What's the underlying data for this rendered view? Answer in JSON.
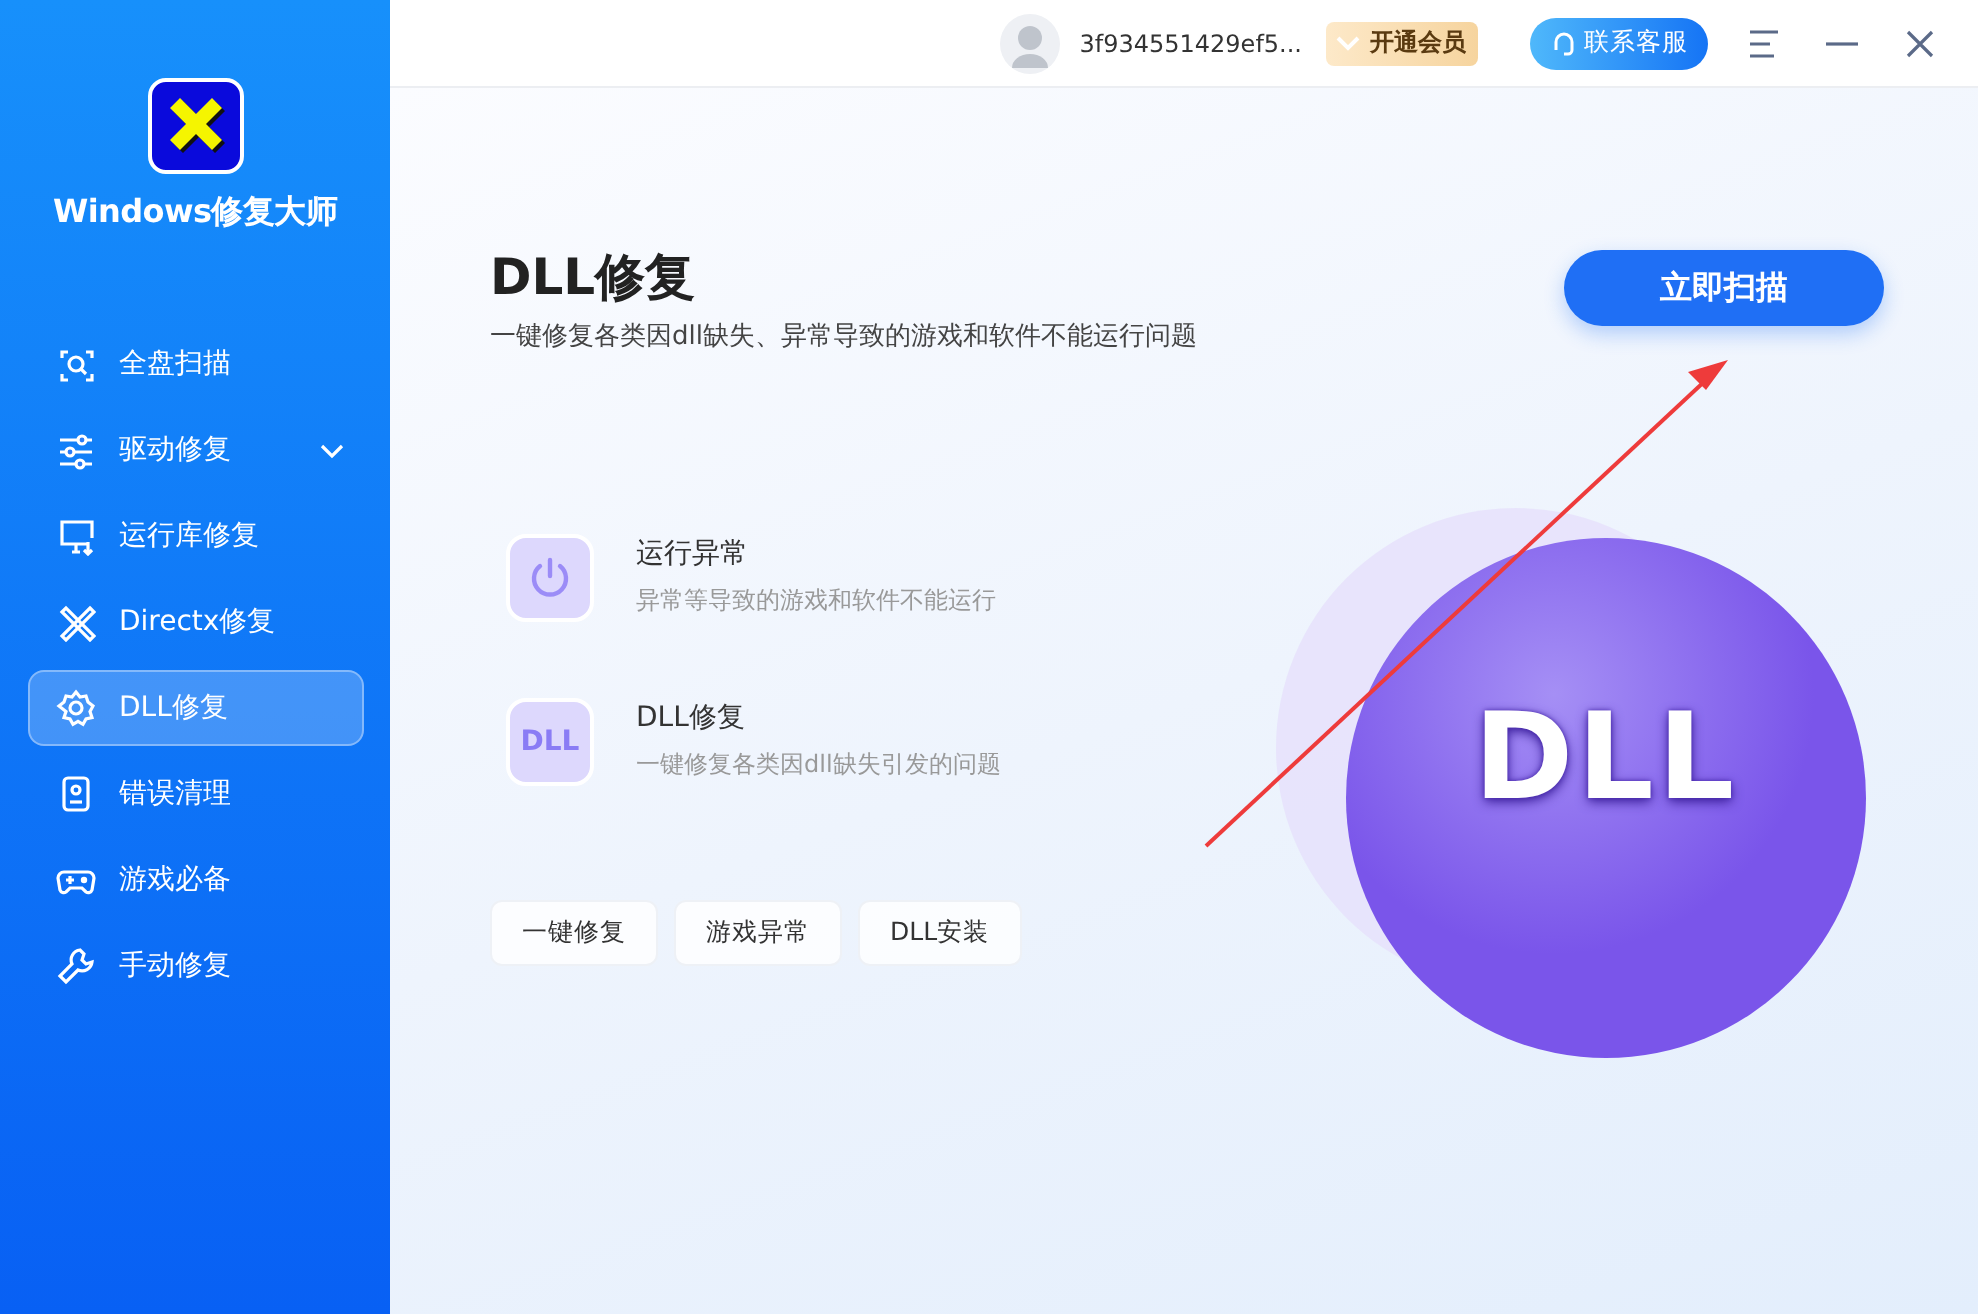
{
  "app": {
    "title": "Windows修复大师"
  },
  "sidebar": {
    "items": [
      {
        "label": "全盘扫描",
        "selected": false
      },
      {
        "label": "驱动修复",
        "selected": false,
        "expanded": false
      },
      {
        "label": "运行库修复",
        "selected": false
      },
      {
        "label": "Directx修复",
        "selected": false
      },
      {
        "label": "DLL修复",
        "selected": true
      },
      {
        "label": "错误清理",
        "selected": false
      },
      {
        "label": "游戏必备",
        "selected": false
      },
      {
        "label": "手动修复",
        "selected": false
      }
    ]
  },
  "topbar": {
    "user": "3f934551429ef5...",
    "vip_button": "开通会员",
    "service_button": "联系客服"
  },
  "page": {
    "title": "DLL修复",
    "subtitle": "一键修复各类因dll缺失、异常导致的游戏和软件不能运行问题",
    "scan_button": "立即扫描",
    "features": [
      {
        "kind": "power",
        "title": "运行异常",
        "description": "异常等导致的游戏和软件不能运行"
      },
      {
        "kind": "dll",
        "icon_text": "DLL",
        "title": "DLL修复",
        "description": "一键修复各类因dll缺失引发的问题"
      }
    ],
    "chips": [
      "一键修复",
      "游戏异常",
      "DLL安装"
    ],
    "orb_label": "DLL"
  }
}
